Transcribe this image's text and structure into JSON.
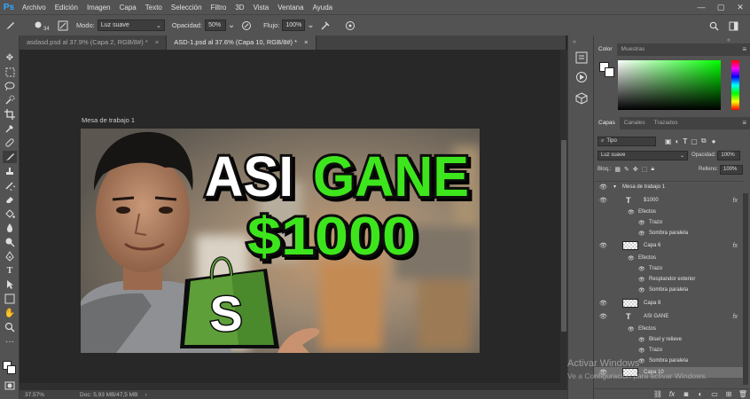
{
  "menubar": {
    "logo": "Ps",
    "items": [
      "Archivo",
      "Edición",
      "Imagen",
      "Capa",
      "Texto",
      "Selección",
      "Filtro",
      "3D",
      "Vista",
      "Ventana",
      "Ayuda"
    ],
    "window_controls": [
      "—",
      "▢",
      "✕"
    ]
  },
  "options": {
    "brush_size": "34",
    "mode_label": "Modo:",
    "mode_value": "Luz suave",
    "opacity_label": "Opacidad:",
    "opacity_value": "50%",
    "flow_label": "Flujo:",
    "flow_value": "100%"
  },
  "tabs": [
    {
      "label": "asdasd.psd al 37.9% (Capa 2, RGB/8#) *",
      "active": false
    },
    {
      "label": "ASD-1.psd al 37.6% (Capa 10, RGB/8#) *",
      "active": true
    }
  ],
  "canvas": {
    "artboard_label": "Mesa de trabajo 1",
    "headline_1": "ASI",
    "headline_2": "GANE",
    "headline_3": "$1000",
    "logo_letter": "S",
    "colors": {
      "headline_white": "#ffffff",
      "headline_green": "#3ee61b",
      "logo_green": "#5e9f3a"
    }
  },
  "status": {
    "zoom": "37.57%",
    "doc": "Doc: 5,93 MB/47,5 MB"
  },
  "color_panel": {
    "tabs": [
      "Color",
      "Muestras"
    ]
  },
  "layers_panel": {
    "tabs": [
      "Capas",
      "Canales",
      "Trazados"
    ],
    "filter_label": "Tipo",
    "blend_mode": "Luz suave",
    "opacity_label": "Opacidad:",
    "opacity_value": "100%",
    "lock_label": "Bloq.:",
    "fill_label": "Relleno:",
    "fill_value": "100%",
    "rows": [
      {
        "name": "Mesa de trabajo 1",
        "kind": "group"
      },
      {
        "name": "$1000",
        "kind": "text",
        "fx": "fx"
      },
      {
        "name": "Efectos",
        "kind": "effects"
      },
      {
        "name": "Trazo",
        "kind": "effect"
      },
      {
        "name": "Sombra paralela",
        "kind": "effect"
      },
      {
        "name": "Capa 6",
        "kind": "layer",
        "fx": "fx"
      },
      {
        "name": "Efectos",
        "kind": "effects"
      },
      {
        "name": "Trazo",
        "kind": "effect"
      },
      {
        "name": "Resplandor exterior",
        "kind": "effect"
      },
      {
        "name": "Sombra paralela",
        "kind": "effect"
      },
      {
        "name": "Capa 8",
        "kind": "layer"
      },
      {
        "name": "ASI GANE",
        "kind": "text",
        "fx": "fx"
      },
      {
        "name": "Efectos",
        "kind": "effects"
      },
      {
        "name": "Bisel y relieve",
        "kind": "effect"
      },
      {
        "name": "Trazo",
        "kind": "effect"
      },
      {
        "name": "Sombra paralela",
        "kind": "effect"
      },
      {
        "name": "Capa 10",
        "kind": "layer",
        "selected": true
      }
    ]
  },
  "watermark": {
    "line1": "Activar Windows",
    "line2": "Ve a Configuración para activar Windows."
  }
}
